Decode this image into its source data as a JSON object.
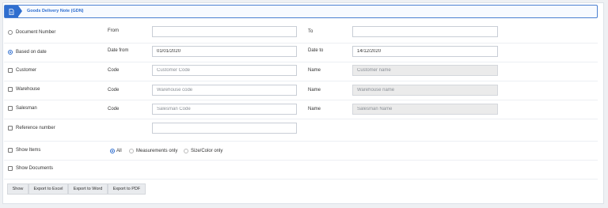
{
  "header": {
    "title": "Goods Delivery Note (GDN)"
  },
  "document_number": {
    "option_label": "Document Number",
    "from_label": "From",
    "from_value": "",
    "to_label": "To",
    "to_value": ""
  },
  "based_on_date": {
    "option_label": "Based on date",
    "date_from_label": "Date from",
    "date_from_value": "01/01/2020",
    "date_to_label": "Date to",
    "date_to_value": "14/12/2020"
  },
  "customer": {
    "label": "Customer",
    "code_label": "Code",
    "code_placeholder": "Customer Code",
    "name_label": "Name",
    "name_placeholder": "Customer name"
  },
  "warehouse": {
    "label": "Warehouse",
    "code_label": "Code",
    "code_placeholder": "Warehouse code",
    "name_label": "Name",
    "name_placeholder": "Warehouse name"
  },
  "salesman": {
    "label": "Salesman",
    "code_label": "Code",
    "code_placeholder": "Salesman Code",
    "name_label": "Name",
    "name_placeholder": "Salesman Name"
  },
  "reference": {
    "label": "Reference number",
    "value": ""
  },
  "show_items": {
    "label": "Show Items",
    "options": [
      "All",
      "Measurements only",
      "Size/Color only"
    ],
    "selected": "All"
  },
  "show_documents": {
    "label": "Show Documents"
  },
  "buttons": {
    "show": "Show",
    "excel": "Export to Excel",
    "word": "Export to Word",
    "pdf": "Export to PDF"
  },
  "colors": {
    "accent": "#2f6ecf",
    "background": "#eef0f3",
    "panel": "#ffffff"
  },
  "icons": {
    "header": "document-icon"
  }
}
